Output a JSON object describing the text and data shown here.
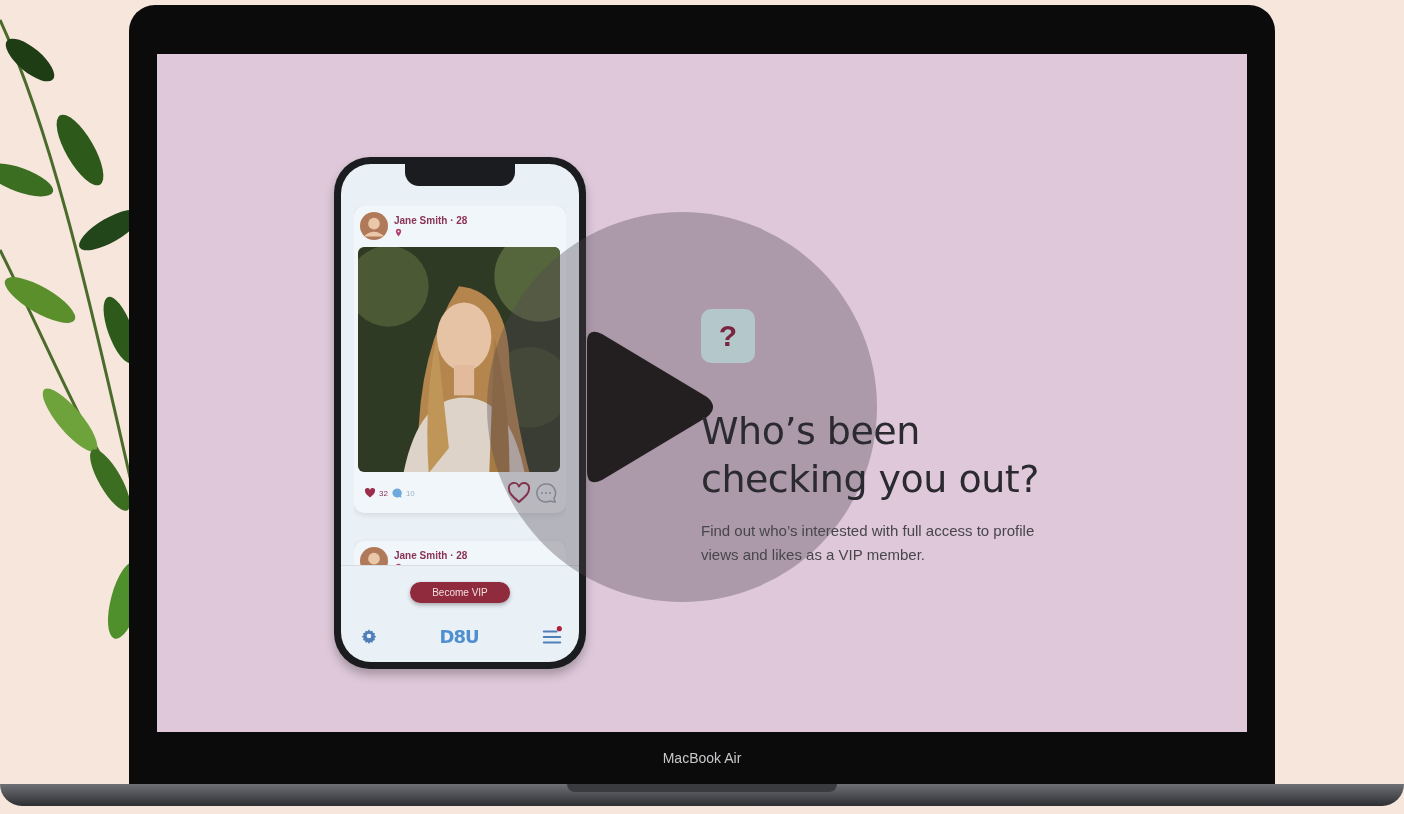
{
  "device": {
    "label": "MacBook Air"
  },
  "feed": {
    "posts": [
      {
        "kind": "full",
        "name": "Jane Smith · 28",
        "likes": "32",
        "comments": "10",
        "liked": false
      },
      {
        "kind": "partial",
        "name": "Jane Smith · 28"
      }
    ]
  },
  "vip_button": "Become VIP",
  "tab_bar": {
    "logo": "D8U",
    "menu_notification": true
  },
  "promo": {
    "icon": "?",
    "heading": "Who’s been checking you out?",
    "text": "Find out who’s interested with full access to profile views and likes as a VIP member."
  }
}
